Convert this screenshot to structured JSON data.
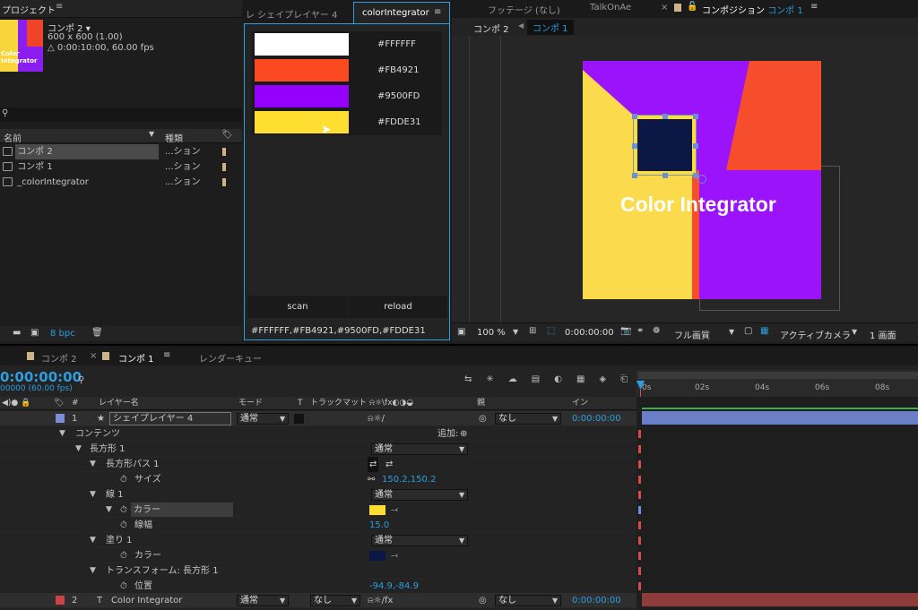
{
  "project": {
    "title": "プロジェクト",
    "comp_name": "コンポ 2 ▾",
    "size": "600 x 600 (1.00)",
    "duration": "△ 0:00:10:00, 60.00 fps",
    "search_placeholder": "",
    "col_name": "名前",
    "col_type": "種類",
    "items": [
      {
        "name": "コンポ 2",
        "type": "...ション"
      },
      {
        "name": "コンポ 1",
        "type": "...ション"
      },
      {
        "name": "_colorIntegrator",
        "type": "...ション"
      }
    ],
    "bpc": "8 bpc"
  },
  "panel": {
    "tab_inactive": "レ シェイプレイヤー 4",
    "tab_active": "colorIntegrator",
    "colors": [
      {
        "hex": "#FFFFFF",
        "swatch": "#FFFFFF"
      },
      {
        "hex": "#FB4921",
        "swatch": "#FB4921"
      },
      {
        "hex": "#9500FD",
        "swatch": "#9500FD"
      },
      {
        "hex": "#FDDE31",
        "swatch": "#FDDE31"
      }
    ],
    "scan": "scan",
    "reload": "reload",
    "output": "#FFFFFF,#FB4921,#9500FD,#FDDE31"
  },
  "viewer": {
    "tab_footage": "フッテージ (なし)",
    "tab_talk": "TalkOnAe",
    "tab_comp_prefix": "コンポジション",
    "tab_comp_name": "コンポ 1",
    "crumb1": "コンポ 2",
    "crumb2": "コンポ 1",
    "canvas_text": "Color Integrator",
    "zoom": "100 %",
    "time": "0:00:00:00",
    "quality": "フル画質",
    "camera": "アクティブカメラ",
    "views": "1 画面"
  },
  "timeline": {
    "tab1": "コンポ 2",
    "tab2": "コンポ 1",
    "tab3": "レンダーキュー",
    "timecode": "0:00:00:00",
    "fps": "00000 (60.00 fps)",
    "col_num": "#",
    "col_layer": "レイヤー名",
    "col_mode": "モード",
    "col_t": "T",
    "col_track": "トラックマット",
    "col_parent": "親",
    "col_in": "イン",
    "add_label": "追加:",
    "ruler": [
      "0s",
      "02s",
      "04s",
      "06s",
      "08s"
    ],
    "layers": [
      {
        "num": "1",
        "name": "シェイプレイヤー 4",
        "mode": "通常",
        "parent": "なし",
        "in": "0:00:00:00",
        "label": "#7a8fd8"
      },
      {
        "num": "2",
        "name": "Color Integrator",
        "mode": "通常",
        "track": "なし",
        "parent": "なし",
        "in": "0:00:00:00",
        "label": "#c94444"
      }
    ],
    "props": {
      "contents": "コンテンツ",
      "rect": "長方形 1",
      "rect_path": "長方形パス 1",
      "size": "サイズ",
      "size_val": "150.2,150.2",
      "stroke": "線 1",
      "stroke_mode": "通常",
      "color": "カラー",
      "stroke_color": "#FDDE31",
      "width": "線幅",
      "width_val": "15.0",
      "fill": "塗り 1",
      "fill_mode": "通常",
      "fill_color": "#0B1744",
      "transform": "トランスフォーム: 長方形 1",
      "position": "位置",
      "position_val": "-94.9,-84.9",
      "rect_mode": "通常"
    }
  }
}
